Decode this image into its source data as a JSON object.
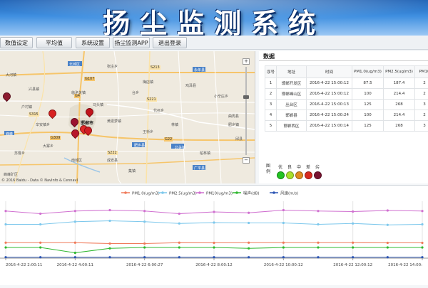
{
  "header": {
    "title": "扬尘监测系统"
  },
  "menu": {
    "items": [
      {
        "label": "数值设定"
      },
      {
        "label": "平均值"
      },
      {
        "label": "系统设置"
      },
      {
        "label": "扬尘监测APP"
      },
      {
        "label": "退出登录"
      }
    ]
  },
  "map": {
    "place_labels": [
      "大河镇",
      "张庄乡",
      "北城区",
      "永年县",
      "兴县镇",
      "台乡",
      "鸡泽县",
      "临洺关镇",
      "梅店镇",
      "小辛庄乡",
      "邯郸市",
      "峰峰矿区",
      "马头镇",
      "黄粱梦镇",
      "南城区",
      "代召乡",
      "曲周县",
      "邱县",
      "肥乡县",
      "成安县",
      "辛安镇乡",
      "苏曹乡",
      "广平县",
      "峰峰",
      "林镇",
      "柏林镇",
      "大寨乡",
      "户村镇",
      "北关镇",
      "王桥乡",
      "肥乡镇",
      "集镇"
    ],
    "road_labels": [
      "G107",
      "G309",
      "G22",
      "G4",
      "S213",
      "S315",
      "S222",
      "S221"
    ],
    "attribution": "© 2016 Baidu - Data © NavInfo & CennavI",
    "zoom_in": "+",
    "zoom_out": "−",
    "marker_colors": [
      "#8c1b2e",
      "#d82222",
      "#c0141c",
      "#9b1230",
      "#e02828",
      "#b8172a",
      "#d01d24"
    ]
  },
  "data_panel": {
    "title": "数据",
    "columns": [
      "序号",
      "地址",
      "时间",
      "PM1.0(ug/m3)",
      "PM2.5(ug/m3)",
      "PM10"
    ],
    "rows": [
      [
        "1",
        "邯郸开发区",
        "2016-4-22 15:00:12",
        "87.5",
        "187.4",
        "2"
      ],
      [
        "2",
        "邯郸峰山区",
        "2016-4-22 15:00:12",
        "100",
        "214.4",
        "2"
      ],
      [
        "3",
        "丛台区",
        "2016-4-22 15:00:13",
        "125",
        "268",
        "3"
      ],
      [
        "4",
        "邯郸县",
        "2016-4-22 15:00:24",
        "100",
        "214.4",
        "2"
      ],
      [
        "5",
        "邯郸西区",
        "2016-4-22 15:00:14",
        "125",
        "268",
        "3"
      ]
    ]
  },
  "air_legend": {
    "heading": "图例",
    "levels": [
      {
        "label": "优",
        "color": "#22c322"
      },
      {
        "label": "良",
        "color": "#a7e02a"
      },
      {
        "label": "中",
        "color": "#e08a1e"
      },
      {
        "label": "差",
        "color": "#d8291f"
      },
      {
        "label": "劣",
        "color": "#7a1330"
      }
    ]
  },
  "chart_data": {
    "type": "line",
    "categories": [
      "2016-4-22 2:00:11",
      "",
      "2016-4-22 4:00:11",
      "",
      "2016-4-22 6:00:27",
      "",
      "2016-4-22 8:00:12",
      "",
      "2016-4-22 10:00:12",
      "",
      "2016-4-22 12:00:12",
      "",
      "2016-4-22 14:00:"
    ],
    "series": [
      {
        "name": "PM1.0(ug/m3)",
        "color": "#f07a5a",
        "values": [
          87,
          87,
          87,
          82,
          82,
          87,
          86,
          87,
          87,
          87,
          87,
          86,
          86
        ]
      },
      {
        "name": "PM2.5(ug/m3)",
        "color": "#7ec8ec",
        "values": [
          190,
          190,
          205,
          210,
          205,
          195,
          200,
          198,
          198,
          190,
          195,
          187,
          190
        ]
      },
      {
        "name": "PM10(ug/m3)",
        "color": "#d070d0",
        "values": [
          265,
          250,
          265,
          270,
          265,
          250,
          260,
          255,
          270,
          265,
          262,
          268,
          265
        ]
      },
      {
        "name": "噪声(dB)",
        "color": "#30b830",
        "values": [
          60,
          60,
          30,
          55,
          60,
          60,
          60,
          55,
          60,
          60,
          60,
          60,
          60
        ]
      },
      {
        "name": "风速(m/s)",
        "color": "#2c55b4",
        "values": [
          5,
          5,
          5,
          5,
          5,
          5,
          5,
          5,
          5,
          5,
          5,
          5,
          5
        ]
      }
    ],
    "ylim": [
      0,
      320
    ],
    "grid": true,
    "legend_position": "top-center"
  }
}
